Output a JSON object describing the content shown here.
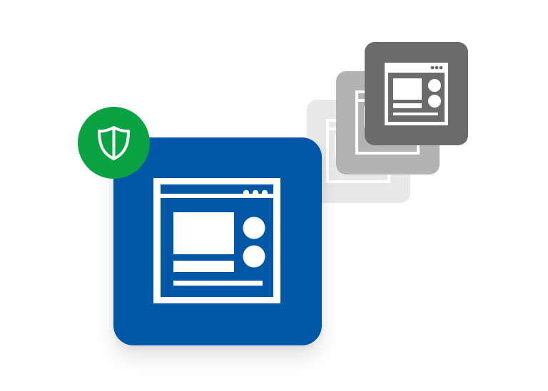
{
  "colors": {
    "main_tile": "#0057a8",
    "badge": "#0aa344",
    "dark_tile": "#6b6b6b",
    "mid_tile": "#b3b3b3",
    "light_tile": "#e8e8e8",
    "glyph": "#ffffff"
  },
  "icons": {
    "badge": "shield-icon",
    "window": "browser-window-icon"
  }
}
